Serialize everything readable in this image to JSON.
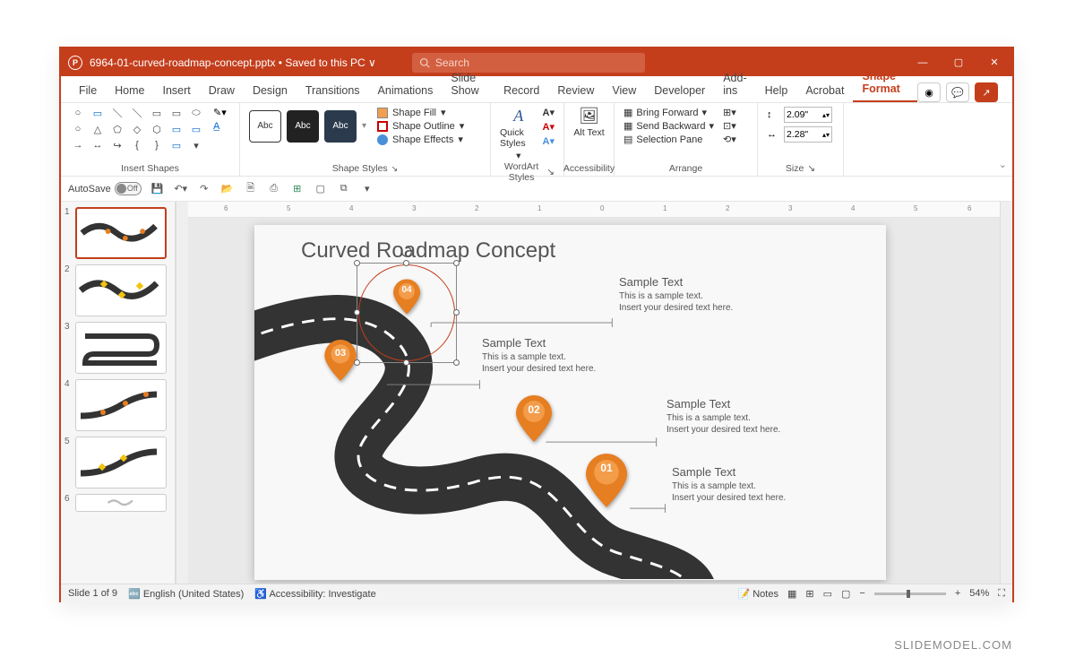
{
  "titlebar": {
    "filename": "6964-01-curved-roadmap-concept.pptx",
    "save_status": "Saved to this PC",
    "search_placeholder": "Search"
  },
  "ribbon": {
    "tabs": [
      "File",
      "Home",
      "Insert",
      "Draw",
      "Design",
      "Transitions",
      "Animations",
      "Slide Show",
      "Record",
      "Review",
      "View",
      "Developer",
      "Add-ins",
      "Help",
      "Acrobat",
      "Shape Format"
    ],
    "active_tab": "Shape Format",
    "groups": {
      "insert_shapes": "Insert Shapes",
      "shape_styles": "Shape Styles",
      "wordart": "WordArt Styles",
      "accessibility": "Accessibility",
      "arrange": "Arrange",
      "size": "Size"
    },
    "abc_label": "Abc",
    "shape_fill": "Shape Fill",
    "shape_outline": "Shape Outline",
    "shape_effects": "Shape Effects",
    "quick_styles": "Quick Styles",
    "alt_text": "Alt Text",
    "bring_forward": "Bring Forward",
    "send_backward": "Send Backward",
    "selection_pane": "Selection Pane",
    "height": "2.09\"",
    "width": "2.28\""
  },
  "qat": {
    "autosave": "AutoSave",
    "autosave_state": "Off"
  },
  "thumbnails": {
    "count": 6,
    "selected": 1
  },
  "slide": {
    "title": "Curved Roadmap Concept",
    "pins": [
      {
        "num": "01"
      },
      {
        "num": "02"
      },
      {
        "num": "03"
      },
      {
        "num": "04"
      }
    ],
    "callouts": [
      {
        "title": "Sample Text",
        "body1": "This is a sample text.",
        "body2": "Insert your desired text here."
      },
      {
        "title": "Sample Text",
        "body1": "This is a sample text.",
        "body2": "Insert your desired text here."
      },
      {
        "title": "Sample Text",
        "body1": "This is a sample text.",
        "body2": "Insert your desired text here."
      },
      {
        "title": "Sample Text",
        "body1": "This is a sample text.",
        "body2": "Insert your desired text here."
      }
    ]
  },
  "statusbar": {
    "slide_indicator": "Slide 1 of 9",
    "language": "English (United States)",
    "accessibility": "Accessibility: Investigate",
    "notes": "Notes",
    "zoom": "54%"
  },
  "watermark": "SLIDEMODEL.COM"
}
